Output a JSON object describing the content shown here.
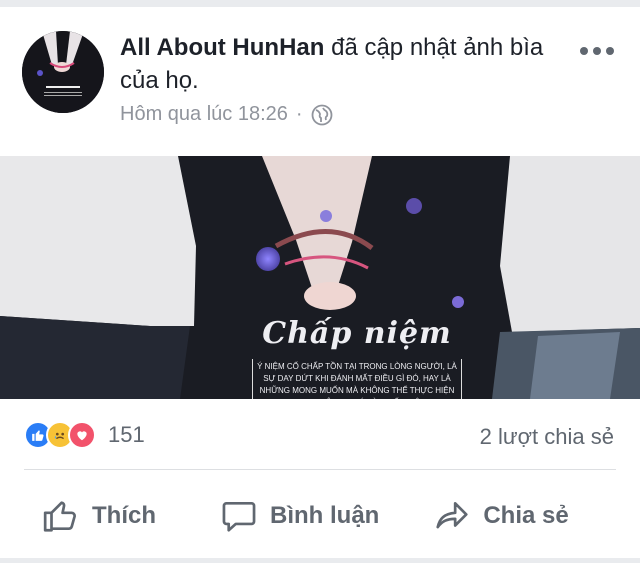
{
  "post": {
    "author": "All About HunHan",
    "action": "đã cập nhật ảnh bìa của họ.",
    "timestamp": "Hôm qua lúc 18:26",
    "separator": "·",
    "audience_icon": "globe-icon",
    "more_icon": "more-options-icon"
  },
  "cover": {
    "title": "Chấp niệm",
    "caption": "Ý NIỆM CỐ CHẤP TỒN TẠI TRONG LÒNG NGƯỜI, LÀ SỰ DAY DỨT KHI ĐÁNH MẤT ĐIỀU GÌ ĐÓ, HAY LÀ NHỮNG MONG MUỐN MÀ KHÔNG THỂ THỰC HIỆN ĐƯỢC ... TÔI GỌI ĐÓ LÀ \"CHẤP NIỆM\""
  },
  "reactions": {
    "types": [
      "like",
      "sad",
      "love"
    ],
    "count": "151"
  },
  "shares_text": "2 lượt chia sẻ",
  "actions": {
    "like": "Thích",
    "comment": "Bình luận",
    "share": "Chia sẻ"
  },
  "colors": {
    "background": "#e9ebee",
    "text_primary": "#1d2129",
    "text_secondary": "#606770",
    "like_blue": "#2a7df6",
    "love_red": "#f2526b",
    "sad_yellow": "#f7c236"
  }
}
